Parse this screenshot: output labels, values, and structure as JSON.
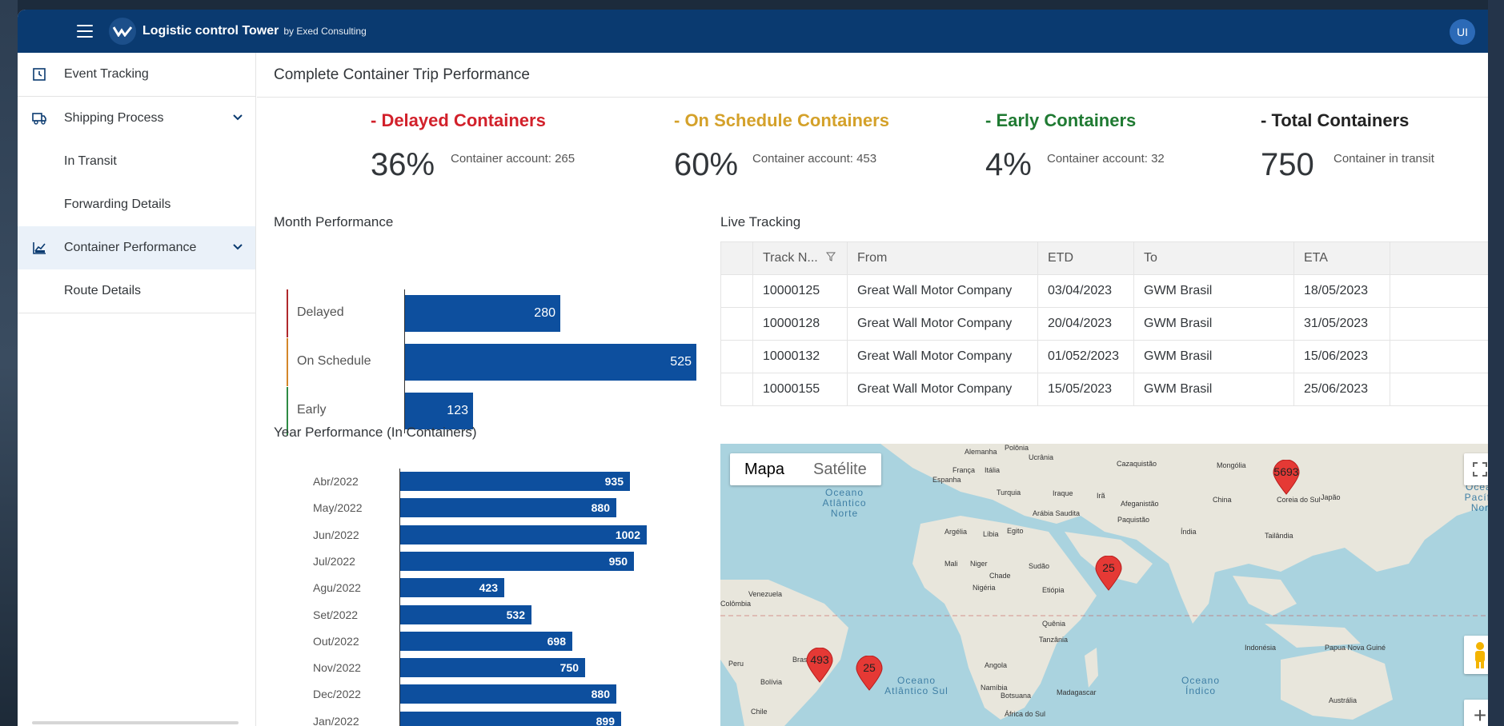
{
  "header": {
    "title": "Logistic control Tower",
    "subtitle": "by Exed Consulting",
    "avatar": "UI",
    "brand_color": "#0a3a70"
  },
  "sidebar": {
    "items": [
      {
        "label": "Event Tracking",
        "icon": "clock-icon"
      },
      {
        "label": "Shipping Process",
        "icon": "truck-icon"
      },
      {
        "label": "In Transit"
      },
      {
        "label": "Forwarding Details"
      },
      {
        "label": "Container Performance",
        "icon": "chart-icon",
        "selected": true
      },
      {
        "label": "Route Details"
      }
    ]
  },
  "page": {
    "title": "Complete Container Trip Performance"
  },
  "kpis": [
    {
      "title": "- Delayed Containers",
      "value": "36%",
      "desc": "Container account: 265",
      "color": "#d2212b"
    },
    {
      "title": "- On Schedule Containers",
      "value": "60%",
      "desc": "Container account: 453",
      "color": "#d4a12a"
    },
    {
      "title": "- Early Containers",
      "value": "4%",
      "desc": "Container account: 32",
      "color": "#1f7a32"
    },
    {
      "title": "- Total Containers",
      "value": "750",
      "desc": "Container in transit",
      "color": "#222222"
    }
  ],
  "month_performance": {
    "title": "Month Performance",
    "chart_data": {
      "type": "bar",
      "categories": [
        "Delayed",
        "On Schedule",
        "Early"
      ],
      "values": [
        280,
        525,
        123
      ],
      "marker_colors": [
        "#b0282c",
        "#d4862a",
        "#2e8b44"
      ]
    }
  },
  "year_performance": {
    "title": "Year Performance (In Containers)",
    "chart_data": {
      "type": "bar",
      "categories": [
        "Abr/2022",
        "May/2022",
        "Jun/2022",
        "Jul/2022",
        "Agu/2022",
        "Set/2022",
        "Out/2022",
        "Nov/2022",
        "Dec/2022",
        "Jan/2022"
      ],
      "values": [
        935,
        880,
        1002,
        950,
        423,
        532,
        698,
        750,
        880,
        899
      ]
    }
  },
  "live_tracking": {
    "title": "Live Tracking",
    "columns": [
      "Track N...",
      "From",
      "ETD",
      "To",
      "ETA"
    ],
    "rows": [
      [
        "10000125",
        "Great Wall Motor Company",
        "03/04/2023",
        "GWM Brasil",
        "18/05/2023"
      ],
      [
        "10000128",
        "Great Wall Motor Company",
        "20/04/2023",
        "GWM Brasil",
        "31/05/2023"
      ],
      [
        "10000132",
        "Great Wall Motor Company",
        "01/052/2023",
        "GWM Brasil",
        "15/06/2023"
      ],
      [
        "10000155",
        "Great Wall Motor Company",
        "15/05/2023",
        "GWM Brasil",
        "25/06/2023"
      ]
    ]
  },
  "map": {
    "tabs": [
      "Mapa",
      "Satélite"
    ],
    "markers": [
      "5693",
      "25",
      "493",
      "25"
    ],
    "countries": [
      "Alemanha",
      "Ucrânia",
      "França",
      "Itália",
      "Espanha",
      "Cazaquistão",
      "Mongólia",
      "Turquia",
      "Iraque",
      "Irã",
      "Afeganistão",
      "China",
      "Coreia do Sul",
      "Japão",
      "Argélia",
      "Líbia",
      "Egito",
      "Arábia Saudita",
      "Paquistão",
      "Índia",
      "Tailândia",
      "Mali",
      "Niger",
      "Chade",
      "Sudão",
      "Nigéria",
      "Etiópia",
      "Venezuela",
      "Colômbia",
      "Quênia",
      "Tanzânia",
      "Indonésia",
      "Papua Nova Guiné",
      "Peru",
      "Brasil",
      "Bolívia",
      "Angola",
      "Namíbia",
      "Botsuana",
      "Madagascar",
      "Chile",
      "África do Sul",
      "Austrália",
      "Polônia"
    ],
    "oceans": [
      "Oceano Atlântico Norte",
      "Oceano Atlântico Sul",
      "Oceano Índico",
      "Oceano Pacífico Norte"
    ]
  }
}
